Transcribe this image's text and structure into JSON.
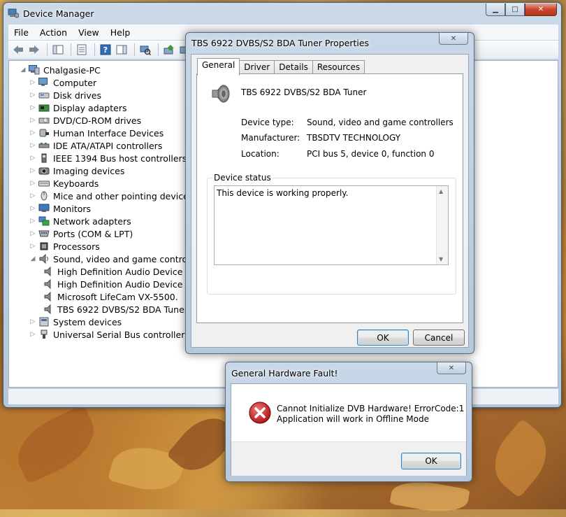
{
  "device_manager": {
    "title": "Device Manager",
    "menu": [
      "File",
      "Action",
      "View",
      "Help"
    ],
    "tree": {
      "root": "Chalgasie-PC",
      "categories": [
        {
          "label": "Computer",
          "icon": "computer-icon"
        },
        {
          "label": "Disk drives",
          "icon": "disk-drive-icon"
        },
        {
          "label": "Display adapters",
          "icon": "display-adapter-icon"
        },
        {
          "label": "DVD/CD-ROM drives",
          "icon": "dvd-drive-icon"
        },
        {
          "label": "Human Interface Devices",
          "icon": "hid-icon"
        },
        {
          "label": "IDE ATA/ATAPI controllers",
          "icon": "ide-controller-icon"
        },
        {
          "label": "IEEE 1394 Bus host controllers",
          "icon": "ieee1394-icon"
        },
        {
          "label": "Imaging devices",
          "icon": "camera-icon"
        },
        {
          "label": "Keyboards",
          "icon": "keyboard-icon"
        },
        {
          "label": "Mice and other pointing devices",
          "icon": "mouse-icon"
        },
        {
          "label": "Monitors",
          "icon": "monitor-icon"
        },
        {
          "label": "Network adapters",
          "icon": "network-icon"
        },
        {
          "label": "Ports (COM & LPT)",
          "icon": "port-icon"
        },
        {
          "label": "Processors",
          "icon": "processor-icon"
        },
        {
          "label": "Sound, video and game controllers",
          "icon": "speaker-icon",
          "expanded": true
        },
        {
          "label": "System devices",
          "icon": "system-icon"
        },
        {
          "label": "Universal Serial Bus controllers",
          "icon": "usb-icon"
        }
      ],
      "sound_children": [
        "High Definition Audio Device",
        "High Definition Audio Device",
        "Microsoft LifeCam VX-5500.",
        "TBS 6922 DVBS/S2 BDA Tuner"
      ]
    }
  },
  "properties_dialog": {
    "title": "TBS 6922 DVBS/S2 BDA Tuner Properties",
    "tabs": [
      "General",
      "Driver",
      "Details",
      "Resources"
    ],
    "device_name": "TBS 6922 DVBS/S2 BDA Tuner",
    "fields": [
      {
        "label": "Device type:",
        "value": "Sound, video and game controllers"
      },
      {
        "label": "Manufacturer:",
        "value": "TBSDTV TECHNOLOGY"
      },
      {
        "label": "Location:",
        "value": "PCI bus 5, device 0, function 0"
      }
    ],
    "status_group_title": "Device status",
    "status_text": "This device is working properly.",
    "ok_label": "OK",
    "cancel_label": "Cancel"
  },
  "fault_dialog": {
    "title": "General Hardware Fault!",
    "message_line1": "Cannot Initialize DVB Hardware! ErrorCode:1",
    "message_line2": "Application will work in Offline Mode",
    "ok_label": "OK"
  },
  "colors": {
    "error_red": "#c8232b",
    "selection_blue": "#3399ff"
  }
}
